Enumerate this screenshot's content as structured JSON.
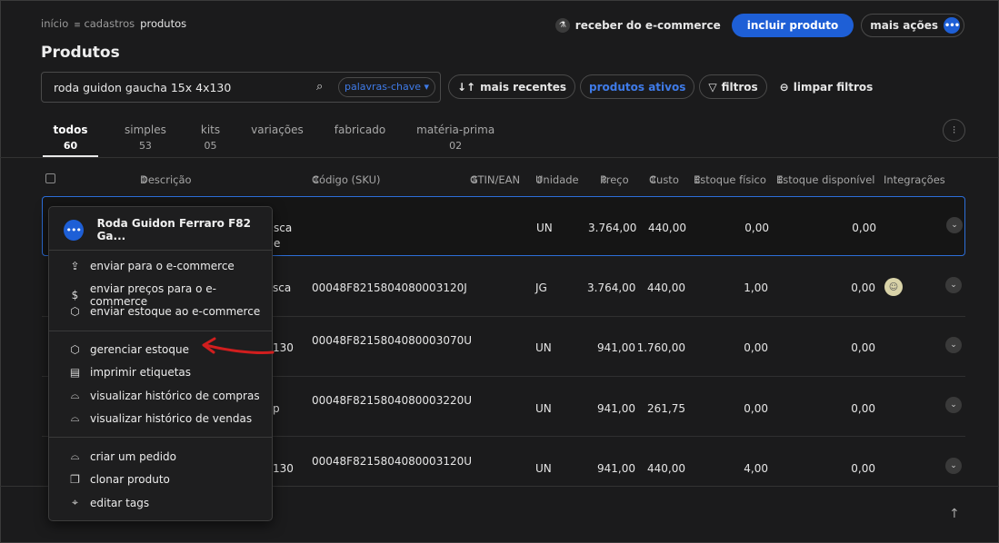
{
  "breadcrumb": {
    "home": "início",
    "section": "cadastros",
    "current": "produtos"
  },
  "page_title": "Produtos",
  "top_actions": {
    "ecommerce": "receber do e-commerce",
    "include": "incluir produto",
    "more": "mais ações"
  },
  "search": {
    "value": "roda guidon gaucha 15x 4x130",
    "keyword_mode": "palavras-chave ▾"
  },
  "filters": {
    "sort": "mais recentes",
    "active": "produtos ativos",
    "filters": "filtros",
    "clear": "limpar filtros"
  },
  "tabs": [
    {
      "label": "todos",
      "count": "60"
    },
    {
      "label": "simples",
      "count": "53"
    },
    {
      "label": "kits",
      "count": "05"
    },
    {
      "label": "variações",
      "count": ""
    },
    {
      "label": "fabricado",
      "count": ""
    },
    {
      "label": "matéria-prima",
      "count": "02"
    }
  ],
  "table": {
    "headers": {
      "description": "Descrição",
      "sku": "Código (SKU)",
      "gtin": "GTIN/EAN",
      "unit": "Unidade",
      "price": "Preço",
      "cost": "Custo",
      "physical": "Estoque físico",
      "available": "Estoque disponível",
      "integrations": "Integrações"
    },
    "rows": [
      {
        "desc": "sca",
        "desc2": "e",
        "sku": "",
        "unit": "UN",
        "price": "3.764,00",
        "cost": "440,00",
        "physical": "0,00",
        "available": "0,00"
      },
      {
        "desc": "sca",
        "desc2": "",
        "sku": "00048F8215804080003120J",
        "unit": "JG",
        "price": "3.764,00",
        "cost": "440,00",
        "physical": "1,00",
        "available": "0,00"
      },
      {
        "desc": "130",
        "desc2": "",
        "sku": "00048F8215804080003070U",
        "unit": "UN",
        "price": "941,00",
        "cost": "1.760,00",
        "physical": "0,00",
        "available": "0,00"
      },
      {
        "desc": "p",
        "desc2": "",
        "sku": "00048F8215804080003220U",
        "unit": "UN",
        "price": "941,00",
        "cost": "261,75",
        "physical": "0,00",
        "available": "0,00"
      },
      {
        "desc": "130",
        "desc2": "",
        "sku": "00048F8215804080003120U",
        "unit": "UN",
        "price": "941,00",
        "cost": "440,00",
        "physical": "4,00",
        "available": "0,00"
      }
    ]
  },
  "menu": {
    "product_name": "Roda Guidon Ferraro F82 Ga...",
    "group1": [
      "enviar para o e-commerce",
      "enviar preços para o e-commerce",
      "enviar estoque ao e-commerce"
    ],
    "group2": [
      "gerenciar estoque",
      "imprimir etiquetas",
      "visualizar histórico de compras",
      "visualizar histórico de vendas"
    ],
    "group3": [
      "criar um pedido",
      "clonar produto",
      "editar tags"
    ]
  },
  "colors": {
    "accent": "#1e5fd6",
    "annotation_arrow": "#d11e1e"
  }
}
